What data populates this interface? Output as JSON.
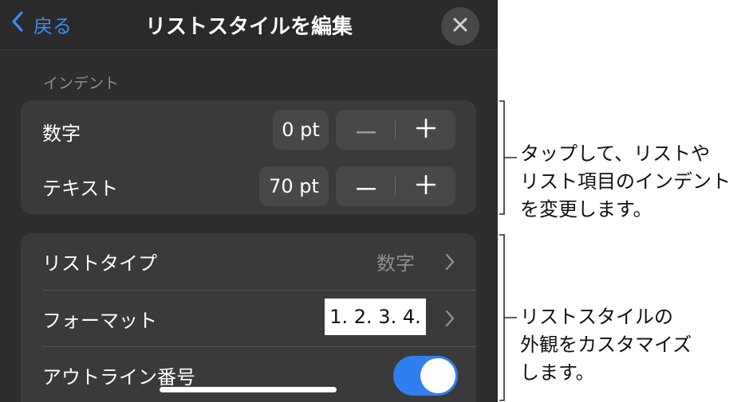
{
  "nav": {
    "back_label": "戻る",
    "title": "リストスタイルを編集"
  },
  "indent": {
    "header": "インデント",
    "rows": [
      {
        "label": "数字",
        "value": "0 pt"
      },
      {
        "label": "テキスト",
        "value": "70 pt"
      }
    ]
  },
  "list_settings": {
    "list_type_label": "リストタイプ",
    "list_type_value": "数字",
    "format_label": "フォーマット",
    "format_value": "1. 2. 3. 4.",
    "outline_label": "アウトライン番号",
    "outline_enabled": true
  },
  "callouts": {
    "indent_lines": [
      "タップして、リストや",
      "リスト項目のインデント",
      "を変更します。"
    ],
    "style_lines": [
      "リストスタイルの",
      "外観をカスタマイズ",
      "します。"
    ]
  },
  "colors": {
    "panel_bg": "#2d2d2f",
    "group_bg": "#3a3a3c",
    "accent_blue": "#3b8cf7",
    "toggle_on": "#2f7ff0"
  }
}
